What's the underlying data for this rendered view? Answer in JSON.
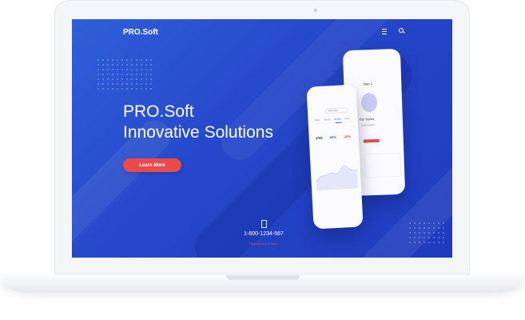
{
  "brand": "PRO.Soft",
  "hero": {
    "title_line1": "PRO.Soft",
    "title_line2": "Innovative Solutions",
    "cta_label": "Learn More"
  },
  "contact": {
    "phone": "1-800-1234-567",
    "callback_label": "Request a Call Back"
  },
  "phone_mockups": {
    "back": {
      "title": "Step 1",
      "subtitle": "Our Name",
      "caption": "Lorem Ipsum"
    },
    "front": {
      "select_label": "Revenue",
      "tabs": [
        "Daily",
        "Week",
        "Month",
        "Year"
      ],
      "stats": [
        {
          "value": "4765",
          "color": "#333333"
        },
        {
          "value": "80%",
          "color": "#3b5bdb"
        },
        {
          "value": "-20%",
          "color": "#e94b4b"
        }
      ]
    }
  },
  "icons": {
    "menu": "hamburger-menu-icon",
    "search": "search-icon",
    "phone": "mobile-phone-icon"
  },
  "colors": {
    "screen_bg": "#2547c9",
    "accent": "#e94b4b",
    "laptop": "#f4f5f7"
  }
}
